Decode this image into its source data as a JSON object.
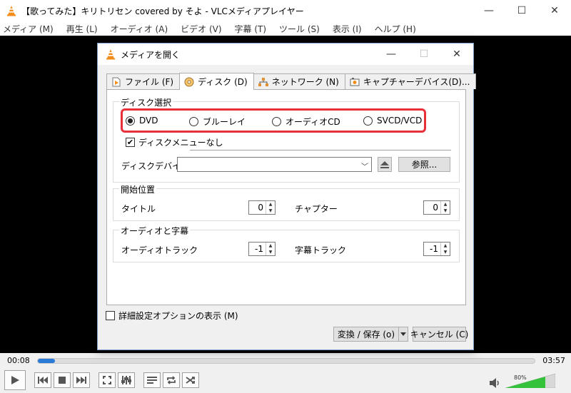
{
  "window": {
    "title": "【歌ってみた】キリトリセン covered by そよ - VLCメディアプレイヤー",
    "minimize": "—",
    "maximize": "☐",
    "close": "✕"
  },
  "menu": [
    "メディア (M)",
    "再生 (L)",
    "オーディオ (A)",
    "ビデオ (V)",
    "字幕 (T)",
    "ツール (S)",
    "表示 (I)",
    "ヘルプ (H)"
  ],
  "player": {
    "time_current": "00:08",
    "time_total": "03:57",
    "progress": 0.035,
    "volume_label": "80%",
    "volume": 0.8
  },
  "dialog": {
    "title": "メディアを開く",
    "tabs": [
      {
        "label": "ファイル (F)",
        "icon": "file-icon"
      },
      {
        "label": "ディスク (D)",
        "icon": "disc-icon"
      },
      {
        "label": "ネットワーク (N)",
        "icon": "network-icon"
      },
      {
        "label": "キャプチャーデバイス(D)...",
        "icon": "capture-icon"
      }
    ],
    "disc_group": {
      "label": "ディスク選択",
      "options": [
        "DVD",
        "ブルーレイ",
        "オーディオCD",
        "SVCD/VCD"
      ],
      "selected": "DVD",
      "no_menu_label": "ディスクメニューなし",
      "no_menu_checked": true,
      "device_label": "ディスクデバイス",
      "device_value": "",
      "browse_button": "参照..."
    },
    "start_group": {
      "label": "開始位置",
      "title_label": "タイトル",
      "title_value": "0",
      "chapter_label": "チャプター",
      "chapter_value": "0"
    },
    "audio_group": {
      "label": "オーディオと字幕",
      "audio_track_label": "オーディオトラック",
      "audio_track_value": "-1",
      "subtitle_track_label": "字幕トラック",
      "subtitle_track_value": "-1"
    },
    "advanced_label": "詳細設定オプションの表示 (M)",
    "convert_button": "変換 / 保存 (o)",
    "cancel_button": "キャンセル (C)"
  }
}
